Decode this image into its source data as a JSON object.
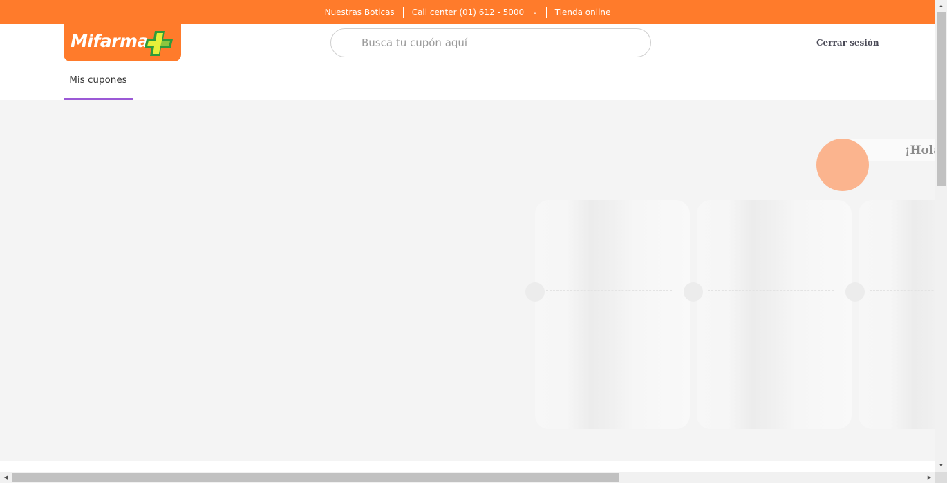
{
  "topbar": {
    "boticas": "Nuestras Boticas",
    "call_center": "Call center (01) 612 - 5000",
    "tienda": "Tienda online",
    "chevron": "⌄"
  },
  "header": {
    "logo_text": "Mifarma",
    "search_placeholder": "Busca tu cupón aquí",
    "logout": "Cerrar sesión",
    "nav_tab": "Mis cupones"
  },
  "greeting": {
    "text": "¡Hola"
  },
  "icons": {
    "logo_cross": "pharmacy-cross-icon",
    "chevron": "chevron-down-icon"
  },
  "colors": {
    "brand_orange": "#ff7b2b",
    "tab_underline": "#9b59d6",
    "avatar": "#fbb48e"
  },
  "coupons_loading": 3
}
